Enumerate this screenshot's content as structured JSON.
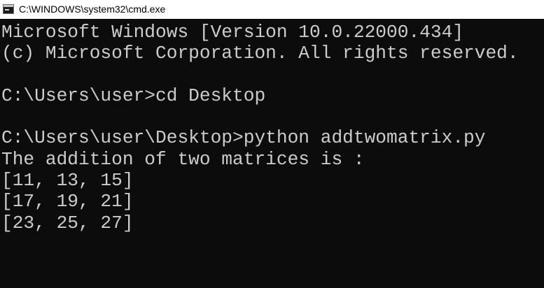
{
  "window": {
    "title": "C:\\WINDOWS\\system32\\cmd.exe",
    "icon": "cmd-console-icon"
  },
  "console": {
    "lines": [
      "Microsoft Windows [Version 10.0.22000.434]",
      "(c) Microsoft Corporation. All rights reserved.",
      "",
      "C:\\Users\\user>cd Desktop",
      "",
      "C:\\Users\\user\\Desktop>python addtwomatrix.py",
      "The addition of two matrices is :",
      "[11, 13, 15]",
      "[17, 19, 21]",
      "[23, 25, 27]"
    ]
  },
  "colors": {
    "console_background": "#0c0c0c",
    "console_text": "#cccccc",
    "titlebar_background": "#ffffff",
    "titlebar_text": "#000000"
  }
}
